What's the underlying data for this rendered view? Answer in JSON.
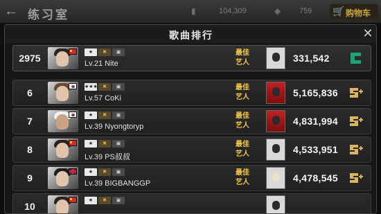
{
  "topbar": {
    "title": "练习室",
    "resource_1": "104,309",
    "resource_2": "759",
    "shop_label": "购物车"
  },
  "modal": {
    "title": "歌曲排行",
    "best_artist_label": "最佳艺人"
  },
  "my_row": {
    "rank": "2975",
    "level": "Lv.21 Nite",
    "score": "331,542",
    "flag": "cn",
    "album": "light",
    "tier": "c-icon"
  },
  "rows": [
    {
      "rank": "6",
      "level": "Lv.57 CoKi",
      "score": "5,165,836",
      "flag": "kr",
      "album": "red",
      "tier": "s-plus-icon"
    },
    {
      "rank": "7",
      "level": "Lv.39 Nyongtoryp",
      "score": "4,831,994",
      "flag": "kr",
      "album": "red",
      "tier": "s-plus-icon"
    },
    {
      "rank": "8",
      "level": "Lv.39 PS叔叔",
      "score": "4,533,951",
      "flag": "cn",
      "album": "light",
      "tier": "s-plus-icon"
    },
    {
      "rank": "9",
      "level": "Lv.39 BIGBANGGP",
      "score": "4,478,545",
      "flag": "gb",
      "album": "light",
      "tier": "s-plus-icon"
    },
    {
      "rank": "10",
      "level": "",
      "score": "",
      "flag": "cn",
      "album": "light",
      "tier": "s-plus-icon"
    }
  ],
  "colors": {
    "accent_gold": "#f2c94c",
    "c_tier": "#1fa37a",
    "s_tier": "#d9b560"
  }
}
